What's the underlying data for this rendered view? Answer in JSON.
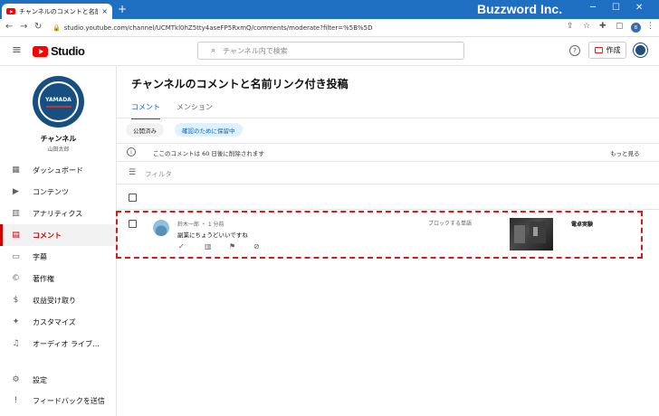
{
  "browser": {
    "tab_title": "チャンネルのコメントと名前リンク付き",
    "close_glyph": "×",
    "newtab_glyph": "+",
    "url": "studio.youtube.com/channel/UCMTkl0hZ5tty4aseFP5RxmQ/comments/moderate?filter=%5B%5D",
    "brand": "Buzzword Inc.",
    "profile_initial": "B"
  },
  "studio": {
    "logo_text": "Studio",
    "search_placeholder": "チャンネル内で検索",
    "create_label": "作成",
    "help_glyph": "?"
  },
  "channel": {
    "avatar_text": "YAMADA",
    "name": "チャンネル",
    "owner": "山田太郎"
  },
  "sidebar": {
    "items": [
      {
        "label": "ダッシュボード",
        "icon": "dashboard-icon",
        "glyph": "▦"
      },
      {
        "label": "コンテンツ",
        "icon": "content-icon",
        "glyph": "▶"
      },
      {
        "label": "アナリティクス",
        "icon": "analytics-icon",
        "glyph": "▥"
      },
      {
        "label": "コメント",
        "icon": "comments-icon",
        "glyph": "▤"
      },
      {
        "label": "字幕",
        "icon": "subtitles-icon",
        "glyph": "▭"
      },
      {
        "label": "著作権",
        "icon": "copyright-icon",
        "glyph": "©"
      },
      {
        "label": "収益受け取り",
        "icon": "earn-icon",
        "glyph": "$"
      },
      {
        "label": "カスタマイズ",
        "icon": "customize-icon",
        "glyph": "✦"
      },
      {
        "label": "オーディオ ライブ…",
        "icon": "audio-library-icon",
        "glyph": "♫"
      },
      {
        "label": "設定",
        "icon": "settings-icon",
        "glyph": "⚙"
      },
      {
        "label": "フィードバックを送信",
        "icon": "feedback-icon",
        "glyph": "!"
      }
    ]
  },
  "main": {
    "title": "チャンネルのコメントと名前リンク付き投稿",
    "tabs": [
      {
        "label": "コメント"
      },
      {
        "label": "メンション"
      }
    ],
    "chips": [
      {
        "label": "公開済み"
      },
      {
        "label": "確認のために保留中"
      }
    ],
    "notice": "ここのコメントは 60 日後に削除されます",
    "more": "もっと見る",
    "filter_placeholder": "フィルタ"
  },
  "comment": {
    "meta": "鈴木一郎 ・ 1 分前",
    "text": "副業にちょうどいいですね",
    "blocked_label": "ブロックする単語",
    "video_title": "電卓実験",
    "actions": [
      {
        "icon": "approve-icon",
        "glyph": "✓"
      },
      {
        "icon": "delete-icon",
        "glyph": "▥"
      },
      {
        "icon": "report-icon",
        "glyph": "⚑"
      },
      {
        "icon": "hide-user-icon",
        "glyph": "⊘"
      }
    ]
  },
  "colors": {
    "accent": "#065fd4",
    "active_nav": "#cc0000",
    "highlight": "#d31c1c",
    "titlebar": "#1e6ec2"
  }
}
